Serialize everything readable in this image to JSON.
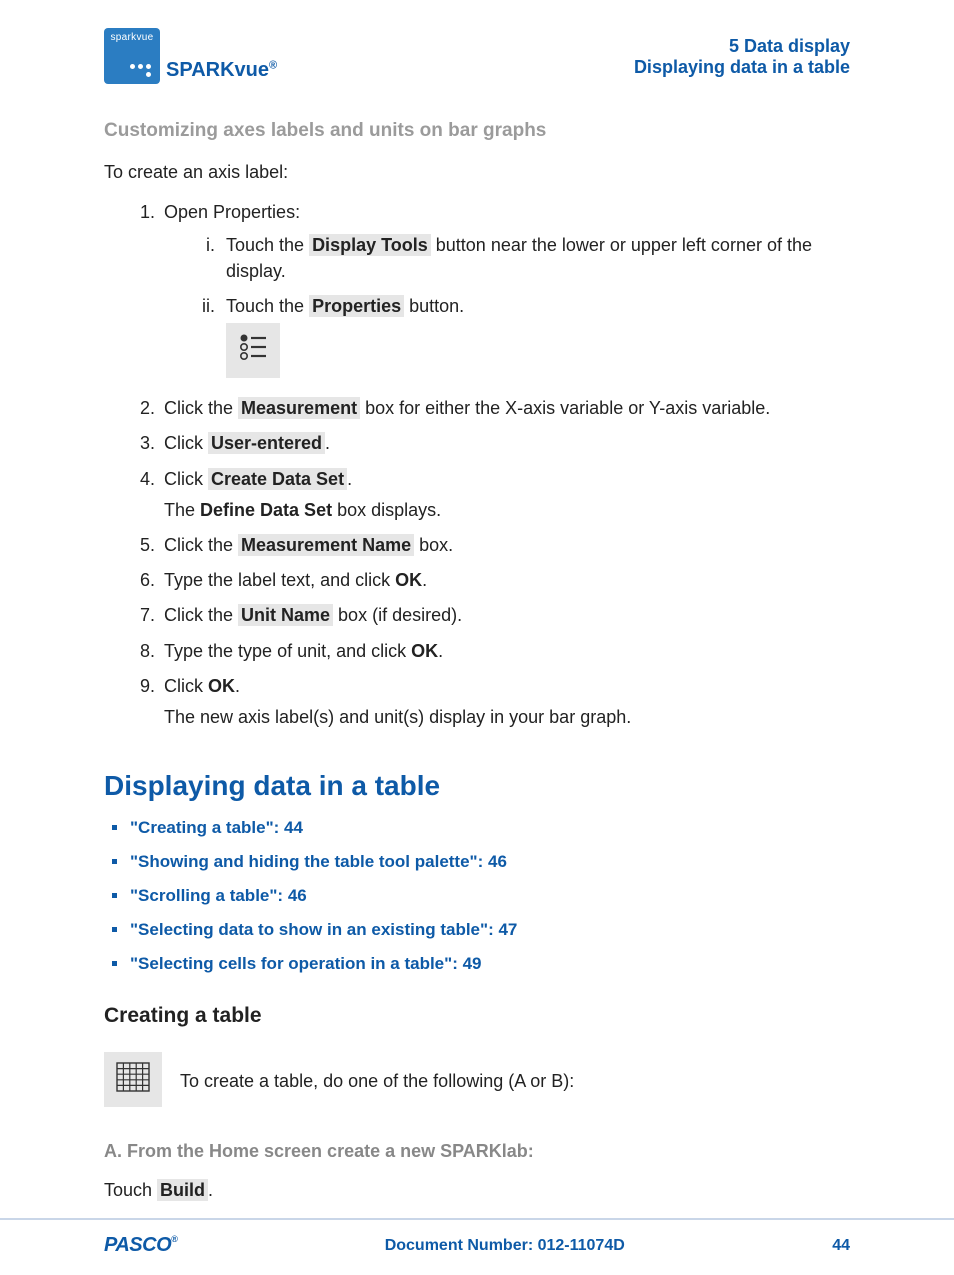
{
  "logo_text": "sparkvue",
  "product_html": "SPARKvue<sup>®</sup>",
  "chapter": "5   Data display",
  "header_section": "Displaying data in a table",
  "h4": "Customizing axes labels and units on bar graphs",
  "intro": "To create an axis label:",
  "step1": "Open Properties:",
  "step1_i_a": "Touch the ",
  "step1_i_b": "Display Tools",
  "step1_i_c": " button near the lower or upper left corner of the display.",
  "step1_ii_a": "Touch the ",
  "step1_ii_b": "Properties",
  "step1_ii_c": " button.",
  "step2_a": "Click the ",
  "step2_b": "Measurement",
  "step2_c": " box for either the X-axis variable or Y-axis variable.",
  "step3_a": "Click ",
  "step3_b": "User-entered",
  "step3_c": ".",
  "step4_a": "Click ",
  "step4_b": "Create Data Set",
  "step4_c": ".",
  "step4_note_a": "The ",
  "step4_note_b": "Define Data Set",
  "step4_note_c": " box displays.",
  "step5_a": "Click the ",
  "step5_b": "Measurement Name",
  "step5_c": " box.",
  "step6_a": "Type the label text, and click ",
  "step6_b": "OK",
  "step6_c": ".",
  "step7_a": "Click the ",
  "step7_b": "Unit Name",
  "step7_c": " box (if desired).",
  "step8_a": "Type the type of unit, and click ",
  "step8_b": "OK",
  "step8_c": ".",
  "step9_a": "Click ",
  "step9_b": "OK",
  "step9_c": ".",
  "step9_note": "The new axis label(s) and unit(s) display in your bar graph.",
  "h2": "Displaying data in a table",
  "toc": [
    "\"Creating a table\":  44",
    "\"Showing and hiding the table tool palette\":  46",
    "\"Scrolling a table\":  46",
    "\"Selecting data to show in an existing table\":  47",
    "\"Selecting cells for operation in a table\":  49"
  ],
  "h3": "Creating a table",
  "create_intro": "To create a table, do one of the following (A or B):",
  "sec_a": "A. From the Home screen create a new SPARKlab:",
  "sec_a_a": "Touch ",
  "sec_a_b": "Build",
  "sec_a_c": ".",
  "doc_num": "Document Number: 012-11074D",
  "page_num": "44",
  "pasco_html": "PASCO<sup>®</sup>"
}
